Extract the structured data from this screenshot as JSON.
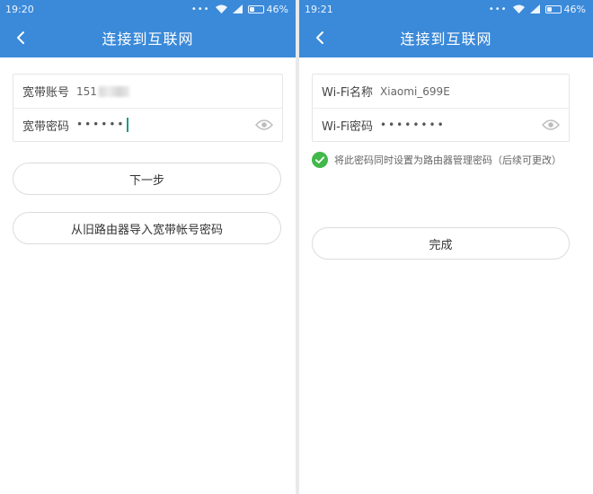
{
  "colors": {
    "appbar": "#3b8ad9",
    "check": "#41b84a",
    "caret": "#1a9b8a"
  },
  "left": {
    "status": {
      "time": "19:20",
      "battery": "46%",
      "battery_level": 0.46
    },
    "title": "连接到互联网",
    "account_label": "宽带账号",
    "account_value": "151",
    "password_label": "宽带密码",
    "password_value": "••••••",
    "next_label": "下一步",
    "import_label": "从旧路由器导入宽带帐号密码"
  },
  "right": {
    "status": {
      "time": "19:21",
      "battery": "46%",
      "battery_level": 0.46
    },
    "title": "连接到互联网",
    "wifi_name_label": "Wi-Fi名称",
    "wifi_name_value": "Xiaomi_699E",
    "wifi_password_label": "Wi-Fi密码",
    "wifi_password_value": "••••••••",
    "sync_text": "将此密码同时设置为路由器管理密码（后续可更改）",
    "done_label": "完成"
  }
}
